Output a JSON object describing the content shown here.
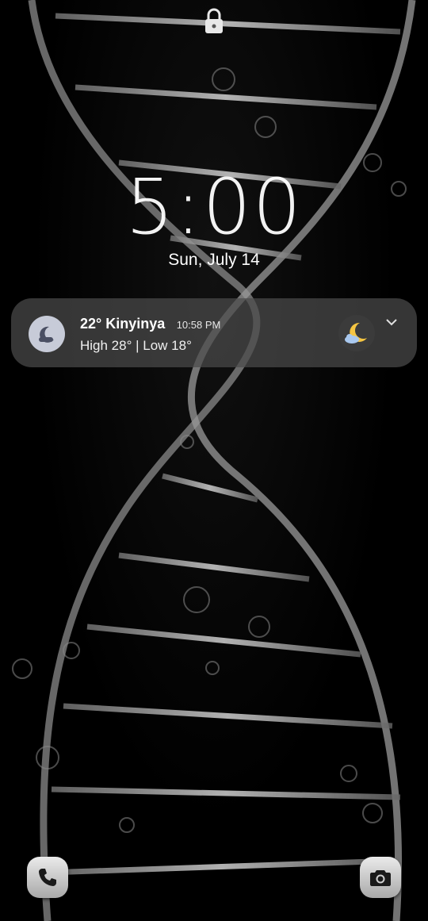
{
  "status": {
    "lock_icon": "lock-icon"
  },
  "clock": {
    "time": "5:00",
    "date": "Sun, July 14"
  },
  "weather_card": {
    "app_icon": "moon-weather-app-icon",
    "title": "22° Kinyinya",
    "time": "10:58 PM",
    "subtitle": "High 28° | Low 18°",
    "condition_icon": "moon-cloud-icon",
    "expand_icon": "chevron-down-icon",
    "colors": {
      "moon": "#f5c542",
      "cloud": "#a9c8ee"
    }
  },
  "shortcuts": {
    "left": "phone-icon",
    "right": "camera-icon"
  },
  "colors": {
    "background": "#000000",
    "card": "#4b4b4b"
  }
}
